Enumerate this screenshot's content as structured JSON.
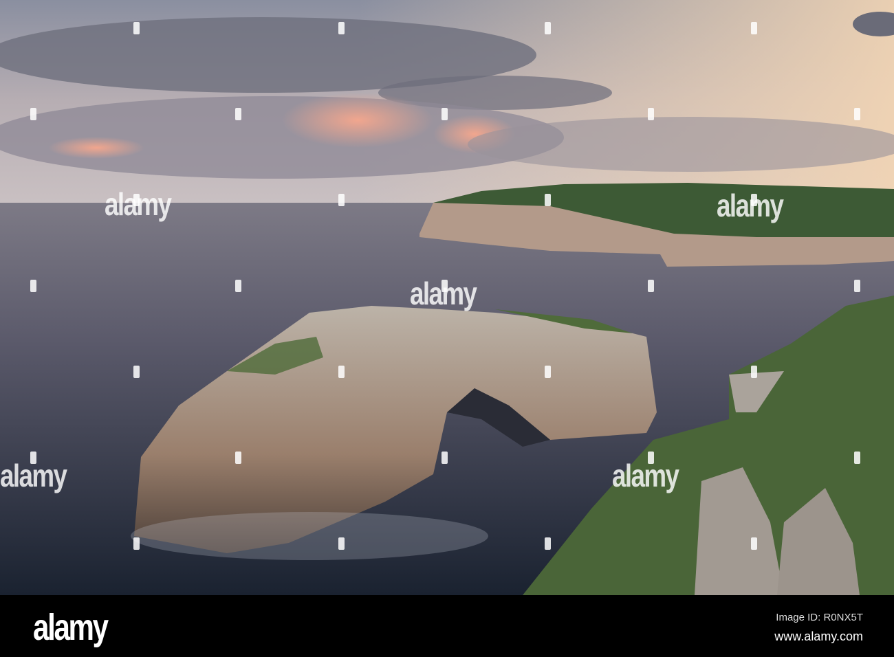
{
  "photo": {
    "subject": "Sea arch at sunset"
  },
  "watermark": {
    "text": "alamy"
  },
  "footer": {
    "logo": "alamy",
    "image_id": "Image ID: R0NX5T",
    "website": "www.alamy.com"
  }
}
